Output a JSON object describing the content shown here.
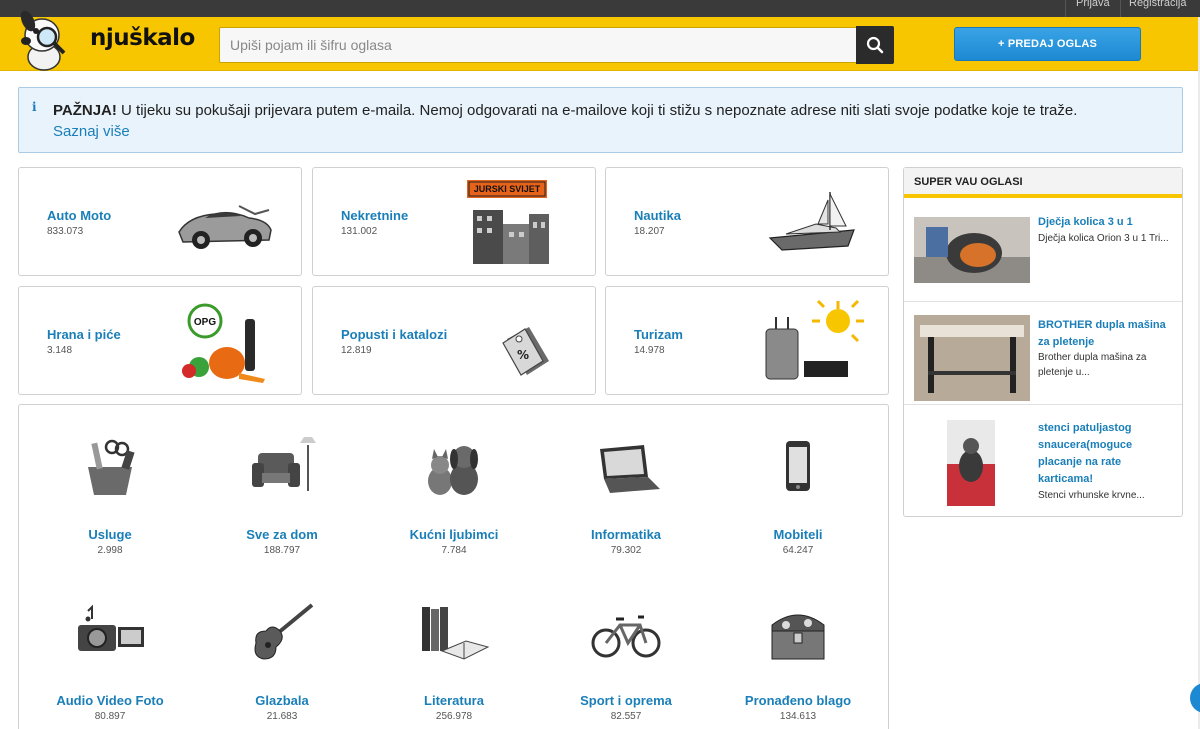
{
  "topbar": {
    "login": "Prijava",
    "register": "Registracija"
  },
  "header": {
    "logo_text": "njuškalo",
    "search_placeholder": "Upiši pojam ili šifru oglasa",
    "sell_label": "+ PREDAJ OGLAS"
  },
  "notice": {
    "icon": "i",
    "bold": "PAŽNJA!",
    "text": " U tijeku su pokušaji prijevara putem e-maila. Nemoj odgovarati na e-mailove koji ti stižu s nepoznate adrese niti slati svoje podatke koje te traže.",
    "more": "Saznaj više"
  },
  "featured": [
    {
      "name": "Auto Moto",
      "count": "833.073",
      "icon": "car-icon"
    },
    {
      "name": "Nekretnine",
      "count": "131.002",
      "icon": "buildings-icon",
      "badge": "JURSKI SVIJET"
    },
    {
      "name": "Nautika",
      "count": "18.207",
      "icon": "boat-icon"
    },
    {
      "name": "Hrana i piće",
      "count": "3.148",
      "icon": "vegetables-icon",
      "badge": "OPG"
    },
    {
      "name": "Popusti i katalozi",
      "count": "12.819",
      "icon": "discount-tag-icon"
    },
    {
      "name": "Turizam",
      "count": "14.978",
      "icon": "suitcase-sun-icon"
    }
  ],
  "categories": [
    {
      "name": "Usluge",
      "count": "2.998",
      "icon": "tools-icon"
    },
    {
      "name": "Sve za dom",
      "count": "188.797",
      "icon": "armchair-icon"
    },
    {
      "name": "Kućni ljubimci",
      "count": "7.784",
      "icon": "pets-icon"
    },
    {
      "name": "Informatika",
      "count": "79.302",
      "icon": "laptop-icon"
    },
    {
      "name": "Mobiteli",
      "count": "64.247",
      "icon": "phone-icon"
    },
    {
      "name": "Audio Video Foto",
      "count": "80.897",
      "icon": "camera-icon"
    },
    {
      "name": "Glazbala",
      "count": "21.683",
      "icon": "guitar-icon"
    },
    {
      "name": "Literatura",
      "count": "256.978",
      "icon": "books-icon"
    },
    {
      "name": "Sport i oprema",
      "count": "82.557",
      "icon": "bicycle-icon"
    },
    {
      "name": "Pronađeno blago",
      "count": "134.613",
      "icon": "treasure-chest-icon"
    }
  ],
  "side": {
    "title": "SUPER VAU OGLASI",
    "ads": [
      {
        "title": "Dječja kolica 3 u 1",
        "desc": "Dječja kolica Orion 3 u 1 Tri..."
      },
      {
        "title": "BROTHER dupla mašina za pletenje",
        "desc": "Brother dupla mašina za pletenje u..."
      },
      {
        "title": "stenci patuljastog snaucera(moguce placanje na rate karticama!",
        "desc": "Stenci vrhunske krvne..."
      }
    ]
  },
  "colors": {
    "brand_yellow": "#f7c600",
    "link_blue": "#1a7fb8",
    "button_blue": "#1d89d2"
  }
}
